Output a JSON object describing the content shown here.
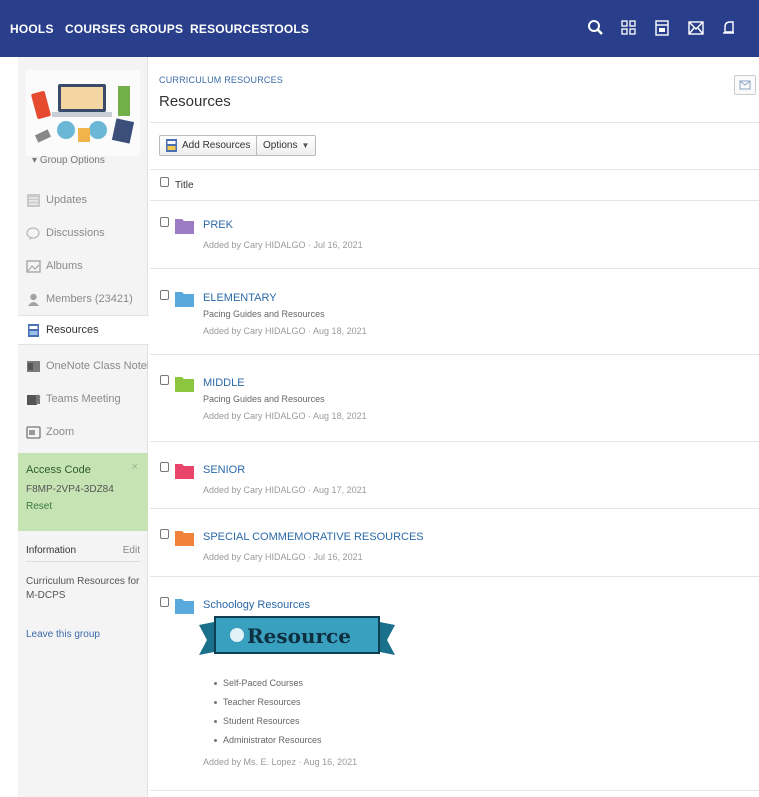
{
  "nav": {
    "links": [
      "HOOLS",
      "COURSES",
      "GROUPS",
      "RESOURCES",
      "TOOLS"
    ],
    "icons": [
      "search-icon",
      "apps-grid-icon",
      "calendar-icon",
      "mail-icon",
      "notification-icon"
    ],
    "bg_color": "#2a3f8c"
  },
  "sidebar": {
    "group_options": "Group Options",
    "items": [
      {
        "label": "Updates",
        "icon": "updates-icon"
      },
      {
        "label": "Discussions",
        "icon": "discussions-icon"
      },
      {
        "label": "Albums",
        "icon": "albums-icon"
      },
      {
        "label": "Members (23421)",
        "icon": "members-icon"
      },
      {
        "label": "Resources",
        "icon": "resources-icon"
      },
      {
        "label": "OneNote Class Notebo...",
        "icon": "onenote-icon"
      },
      {
        "label": "Teams Meeting",
        "icon": "teams-icon"
      },
      {
        "label": "Zoom",
        "icon": "zoom-icon"
      }
    ],
    "access_code": {
      "title": "Access Code",
      "code": "F8MP-2VP4-3DZ84",
      "reset": "Reset",
      "close": "×"
    },
    "information": {
      "label": "Information",
      "edit": "Edit",
      "description": "Curriculum Resources for M-DCPS"
    },
    "leave": "Leave this group"
  },
  "main": {
    "breadcrumb": "CURRICULUM RESOURCES",
    "title": "Resources",
    "toolbar": {
      "add_resources": "Add Resources",
      "options": "Options"
    },
    "column_title": "Title",
    "items": [
      {
        "title": "PREK",
        "subtitle": "",
        "meta": "Added by Cary HIDALGO · Jul 16, 2021",
        "color": "#9b7cc4"
      },
      {
        "title": "ELEMENTARY",
        "subtitle": "Pacing Guides and Resources",
        "meta": "Added by Cary HIDALGO · Aug 18, 2021",
        "color": "#5aa9dd"
      },
      {
        "title": "MIDDLE",
        "subtitle": "Pacing Guides and Resources",
        "meta": "Added by Cary HIDALGO · Aug 18, 2021",
        "color": "#8cc63f"
      },
      {
        "title": "SENIOR",
        "subtitle": "",
        "meta": "Added by Cary HIDALGO · Aug 17, 2021",
        "color": "#e8456a"
      },
      {
        "title": "SPECIAL COMMEMORATIVE RESOURCES",
        "subtitle": "",
        "meta": "Added by Cary HIDALGO · Jul 16, 2021",
        "color": "#f0833a"
      },
      {
        "title": "Schoology Resources",
        "subtitle": "",
        "meta": "Added by Ms. E. Lopez · Aug 16, 2021",
        "color": "#5aa9dd"
      }
    ],
    "banner_text": "Resource",
    "bullets": [
      "Self-Paced Courses",
      "Teacher Resources",
      "Student Resources",
      "Administrator Resources"
    ]
  }
}
